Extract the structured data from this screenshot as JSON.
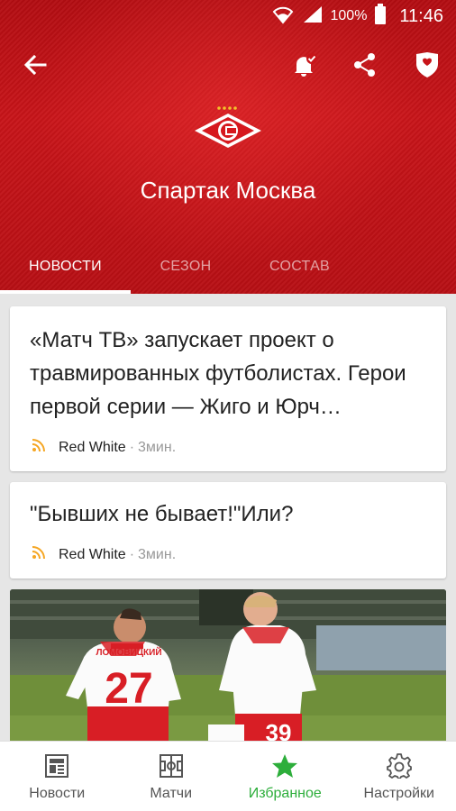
{
  "status_bar": {
    "battery": "100%",
    "time": "11:46",
    "icons": [
      "wifi-icon",
      "signal-icon",
      "battery-icon"
    ]
  },
  "toolbar": {
    "icons": [
      "back-arrow-icon",
      "notification-bell-icon",
      "share-icon",
      "favorite-shield-icon"
    ]
  },
  "team": {
    "name": "Спартак Москва",
    "logo": "spartak-logo"
  },
  "tabs": [
    {
      "label": "НОВОСТИ",
      "active": true
    },
    {
      "label": "СЕЗОН",
      "active": false
    },
    {
      "label": "СОСТАВ",
      "active": false
    }
  ],
  "news": [
    {
      "title": "«Матч ТВ» запускает проект о травмированных футболистах. Герои первой серии — Жиго и Юрч…",
      "source": "Red White",
      "time": "3мин."
    },
    {
      "title": "\"Бывших не бывает!\"Или?",
      "source": "Red White",
      "time": "3мин."
    }
  ],
  "photo_card": {
    "players": [
      {
        "name": "ЛОМОВИЦКИЙ",
        "number": "27"
      },
      {
        "name": "",
        "number": "39"
      }
    ]
  },
  "bottom_nav": [
    {
      "label": "Новости",
      "icon": "news-icon",
      "active": false
    },
    {
      "label": "Матчи",
      "icon": "field-icon",
      "active": false
    },
    {
      "label": "Избранное",
      "icon": "star-icon",
      "active": true
    },
    {
      "label": "Настройки",
      "icon": "gear-icon",
      "active": false
    }
  ],
  "colors": {
    "header_red": "#c81419",
    "accent_green": "#2dae3b",
    "rss_orange": "#f5a623"
  }
}
